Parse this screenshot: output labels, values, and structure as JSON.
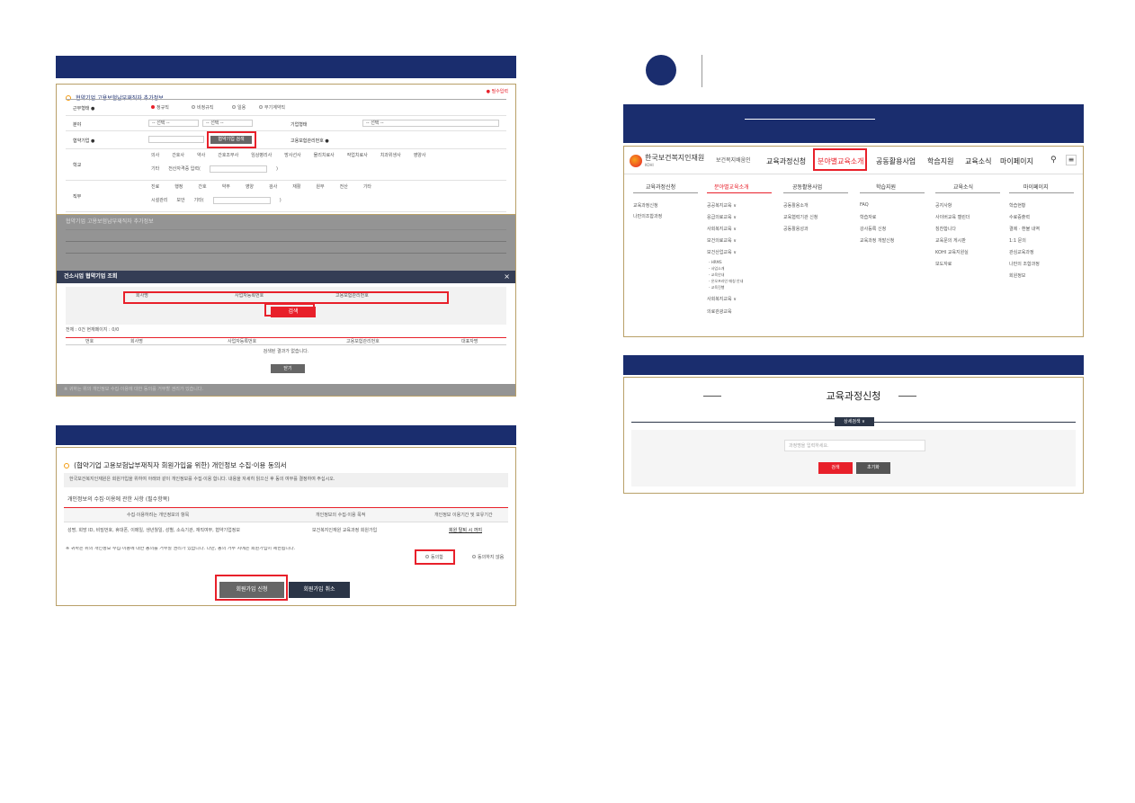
{
  "step_number": "",
  "left": {
    "form1": {
      "title": "협약기업 고용보험납부재직자 추가정보",
      "required_note": "● 필수입력",
      "rows": [
        {
          "label": "근무형태 ●",
          "options": [
            "정규직",
            "비정규직",
            "일용",
            "무기계약직"
          ]
        },
        {
          "label": "분야",
          "select1": "-- 선택 --",
          "select2": "-- 선택 --",
          "label2": "기업형태",
          "select3": "-- 선택 --"
        },
        {
          "label": "협약기업 ●",
          "button": "협약기업 검색",
          "label2": "고용보험관리번호 ●"
        },
        {
          "label": "학교",
          "line1": [
            "의사",
            "간호사",
            "약사",
            "간호조무사",
            "임상병리사",
            "방사선사",
            "물리치료사",
            "작업치료사",
            "치과위생사",
            "영양사"
          ],
          "line2": [
            "기타",
            "전산자격증 입력("
          ]
        },
        {
          "label": "직무",
          "line1": [
            "진료",
            "행정",
            "간호",
            "약무",
            "영양",
            "검사",
            "재활",
            "원무",
            "전산",
            "기타"
          ],
          "line2": [
            "시설관리",
            "보안",
            "기타("
          ]
        }
      ]
    },
    "modal": {
      "bg_title": "협약기업 고용보험납부재직자 추가정보",
      "title": "건소시업 협약기업 조회",
      "fields": [
        "회사명",
        "사업자등록번호",
        "고용보험관리번호"
      ],
      "search_button": "검색",
      "result_text": "전체 : 0건    현재페이지 : 0/0",
      "columns": [
        "번호",
        "회사명",
        "사업자등록번호",
        "고용보험관리번호",
        "대표자명"
      ],
      "empty_text": "검색된 결과가 없습니다.",
      "close_button": "닫기",
      "footer": "※ 귀하는 위의 개인정보 수집·이용에 대한 동의를 거부할 권리가 있습니다."
    },
    "consent": {
      "title": "(협약기업 고용보험납부재직자 회원가입을 위한) 개인정보 수집·이용 동의서",
      "intro": "한국보건복지인재원은 회원가입을 위하여 아래와 같이 개인정보를 수집·이용 합니다. 내용을 자세히 읽으신 후 동의 여부를 결정하여 주십시오.",
      "section": "개인정보의 수집·이용에 관한 사항 (필수항목)",
      "columns": [
        "수집·이용하려는 개인정보의 항목",
        "개인정보의 수집·이용 목적",
        "개인정보 이용기간 및 보유기간"
      ],
      "row": [
        "성명, 희망 ID, 비밀번호, 휴대폰, 이메일, 생년월일, 성별, 소속기관, 재직여부, 협약기업정보",
        "보건복지인재원 교육과정 회원가입",
        "회원 탈퇴 시 까지"
      ],
      "notice": "※ 귀하는 위의 개인정보 수집·이용에 대한 동의를 거부할 권리가 있습니다. 다만, 동의 거부 시에는 회원가입이 제한됩니다.",
      "agree_label": "동의함",
      "disagree_label": "동의하지 않음",
      "join_button": "회원가입 신청",
      "cancel_button": "회원가입 취소"
    }
  },
  "right": {
    "site": {
      "logo_text": "한국보건복지인재원",
      "logo_sub": "KOHI",
      "slogan": "보건복지배움인",
      "menu": [
        "교육과정신청",
        "분야별교육소개",
        "공동활용사업",
        "학습지원",
        "교육소식",
        "마이페이지"
      ],
      "columns": [
        {
          "head": "교육과정신청",
          "items": [
            "교육과정신청",
            "나만의조합과정"
          ]
        },
        {
          "head": "분야별교육소개",
          "items": [
            "공공복지교육 ∨",
            "응급의료교육 ∨",
            "사회복지교육 ∨",
            "보건의료교육 ∨",
            "보건산업교육 ∨",
            "- HRMS",
            "- 사업소개",
            "- 교육안내",
            "- 온오프라인 매칭 안내",
            "- 교육진행",
            "사회복지교육 ∨",
            "의료관광교육"
          ]
        },
        {
          "head": "공동활용사업",
          "items": [
            "공동활용소개",
            "교육협력기관 신청",
            "공동활용성과"
          ]
        },
        {
          "head": "학습지원",
          "items": [
            "FAQ",
            "학습자료",
            "강사등록 신청",
            "교육과정 개발신청"
          ]
        },
        {
          "head": "교육소식",
          "items": [
            "공지사항",
            "사이버교육 캘린더",
            "칭찬합니다",
            "교육문의 게시판",
            "KOHI 교육지원실",
            "보도자료"
          ]
        },
        {
          "head": "마이페이지",
          "items": [
            "학습현황",
            "수료증출력",
            "결제 · 환불 내역",
            "1:1 문의",
            "관심교육과정",
            "나만의 조합과정",
            "회원정보"
          ]
        }
      ]
    },
    "search": {
      "title": "교육과정신청",
      "detail_button": "상세검색 ∨",
      "placeholder": "과정명을 입력하세요.",
      "search_button": "검색",
      "reset_button": "초기화"
    }
  },
  "colors": {
    "navy": "#1a2d6e",
    "red": "#e8202a",
    "gold": "#b9a068",
    "orange": "#f39c12"
  }
}
